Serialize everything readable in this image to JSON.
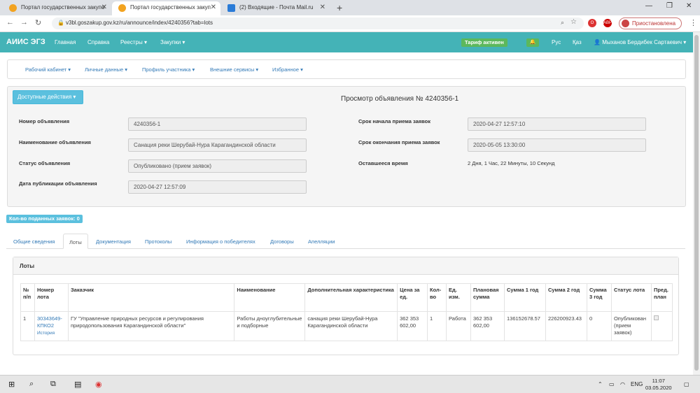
{
  "browser": {
    "tabs": [
      {
        "title": "Портал государственных закупо",
        "active": false
      },
      {
        "title": "Портал государственных закуп",
        "active": true
      },
      {
        "title": "(2) Входящие - Почта Mail.ru",
        "active": false
      }
    ],
    "new_tab": "+",
    "url": "v3bl.goszakup.gov.kz/ru/announce/index/4240356?tab=lots",
    "profile_status": "Приостановлена"
  },
  "topnav": {
    "brand": "АИИС ЭГЗ",
    "items": [
      "Главная",
      "Справка",
      "Реестры ▾",
      "Закупки ▾"
    ],
    "tarif": "Тариф активен",
    "lang_ru": "Рус",
    "lang_kz": "Қаз",
    "user": "Мыханов Бердибек Сартаевич ▾"
  },
  "cabinet_menu": [
    "Рабочий кабинет ▾",
    "Личные данные ▾",
    "Профиль участника ▾",
    "Внешние сервисы ▾",
    "Избранное ▾"
  ],
  "actions_button": "Доступные действия ▾",
  "page_title": "Просмотр объявления № 4240356-1",
  "fields": {
    "number_label": "Номер объявления",
    "number_value": "4240356-1",
    "name_label": "Наименование объявления",
    "name_value": "Санация реки Шерубай-Нура Карагандинской области",
    "status_label": "Статус объявления",
    "status_value": "Опубликовано (прием заявок)",
    "pubdate_label": "Дата публикации объявления",
    "pubdate_value": "2020-04-27 12:57:09",
    "start_label": "Срок начала приема заявок",
    "start_value": "2020-04-27 12:57:10",
    "end_label": "Срок окончания приема заявок",
    "end_value": "2020-05-05 13:30:00",
    "remain_label": "Оставшееся время",
    "remain_value": "2 Дня, 1 Час, 22 Минуты, 10 Секунд"
  },
  "applications_badge": "Кол-во поданных заявок: 0",
  "tabs": [
    "Общие сведения",
    "Лоты",
    "Документация",
    "Протоколы",
    "Информация о победителях",
    "Договоры",
    "Апелляции"
  ],
  "lots": {
    "header": "Лоты",
    "columns": [
      "№ п/п",
      "Номер лота",
      "Заказчик",
      "Наименование",
      "Дополнительная характеристика",
      "Цена за ед.",
      "Кол-во",
      "Ед. изм.",
      "Плановая сумма",
      "Сумма 1 год",
      "Сумма 2 год",
      "Сумма 3 год",
      "Статус лота",
      "Пред. план"
    ],
    "row": {
      "num": "1",
      "lot_number": "30343649-КПКО2",
      "history": "История",
      "customer": "ГУ \"Управление природных ресурсов и регулирования природопользования Карагандинской области\"",
      "name": "Работы дноуглубительные и подборные",
      "extra": "санация реки Шерубай-Нура Карагандинской области",
      "price": "362 353 602,00",
      "qty": "1",
      "unit": "Работа",
      "plan_sum": "362 353 602,00",
      "sum1": "136152678.57",
      "sum2": "226200923.43",
      "sum3": "0",
      "status": "Опубликован (прием заявок)"
    }
  },
  "taskbar": {
    "lang": "ENG",
    "time": "11:07",
    "date": "03.05.2020"
  }
}
